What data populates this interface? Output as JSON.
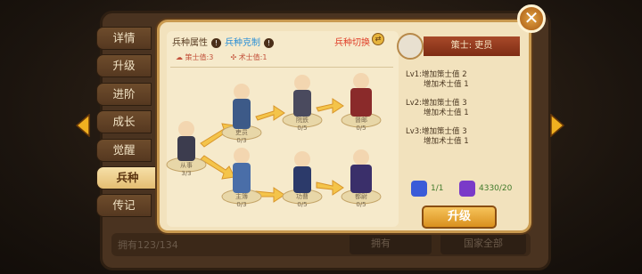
{
  "side_tabs": [
    {
      "label": "详情",
      "active": false
    },
    {
      "label": "升级",
      "active": false
    },
    {
      "label": "进阶",
      "active": false
    },
    {
      "label": "成长",
      "active": false
    },
    {
      "label": "觉醒",
      "active": false
    },
    {
      "label": "兵种",
      "active": true
    },
    {
      "label": "传记",
      "active": false
    }
  ],
  "panel": {
    "attr_label": "兵种属性",
    "counter_label": "兵种克制",
    "switch_label": "兵种切换",
    "stat1": "策士值:3",
    "stat2": "术士值:1"
  },
  "tree": {
    "nodes": [
      {
        "name": "从事",
        "level": "3/3"
      },
      {
        "name": "吏员",
        "level": "0/3"
      },
      {
        "name": "主簿",
        "level": "0/3"
      },
      {
        "name": "督邮",
        "level": "0/5"
      },
      {
        "name": "功曹",
        "level": "0/5"
      },
      {
        "name": "院鉄",
        "level": "0/5"
      },
      {
        "name": "都尉",
        "level": "0/5"
      }
    ]
  },
  "info": {
    "unit_name": "策士: 吏员",
    "levels": [
      {
        "title": "Lv1:增加策士值 2",
        "sub": "增加术士值 1"
      },
      {
        "title": "Lv2:增加策士值 3",
        "sub": "增加术士值 1"
      },
      {
        "title": "Lv3:增加策士值 3",
        "sub": "增加术士值 1"
      }
    ],
    "resource1": "1/1",
    "resource2": "4330/20",
    "upgrade_label": "升级"
  },
  "footer": {
    "owned": "拥有123/134",
    "owned_btn": "拥有",
    "nation_btn": "国家全部"
  },
  "colors": {
    "accent": "#e4bd72",
    "panel_bg": "#f2e2bd",
    "upgrade": "#f6c35a"
  }
}
